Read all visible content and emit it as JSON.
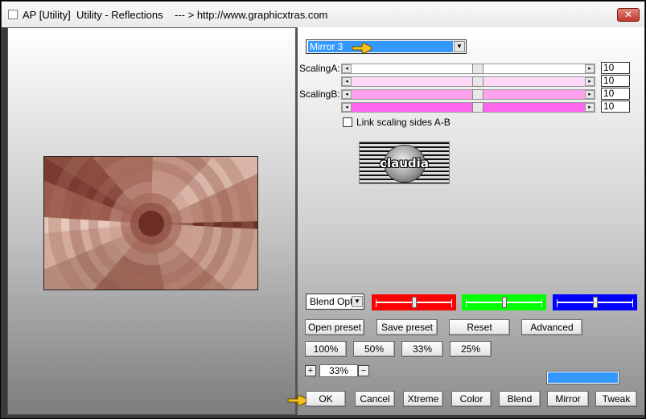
{
  "window": {
    "title": "AP [Utility]  Utility - Reflections    --- > http://www.graphicxtras.com",
    "close_glyph": "✕"
  },
  "mode_dropdown": {
    "value": "Mirror 3"
  },
  "sliders": [
    {
      "label": "ScalingA:",
      "value": "10",
      "color": "#ffffff"
    },
    {
      "label": "",
      "value": "10",
      "color": "#ffd7f7"
    },
    {
      "label": "ScalingB:",
      "value": "10",
      "color": "#ffa2ee"
    },
    {
      "label": "",
      "value": "10",
      "color": "#ff66ee"
    }
  ],
  "link_scaling": {
    "label": "Link scaling sides A-B",
    "checked": false
  },
  "logo": {
    "text": "claudia"
  },
  "blend_dropdown": {
    "value": "Blend Optio"
  },
  "color_sliders": [
    {
      "name": "red",
      "color": "#ff0000",
      "level": 0.5
    },
    {
      "name": "green",
      "color": "#00ff00",
      "level": 0.5
    },
    {
      "name": "blue",
      "color": "#0000ff",
      "level": 0.5
    }
  ],
  "preset_buttons": {
    "open": "Open preset",
    "save": "Save preset",
    "reset": "Reset",
    "advanced": "Advanced"
  },
  "zoom_buttons": [
    "100%",
    "50%",
    "33%",
    "25%"
  ],
  "zoom": {
    "plus": "+",
    "minus": "−",
    "value": "33%"
  },
  "swatch_color": "#3399ff",
  "bottom_buttons": {
    "ok": "OK",
    "cancel": "Cancel",
    "xtreme": "Xtreme",
    "color": "Color",
    "blend": "Blend",
    "mirror": "Mirror",
    "tweak": "Tweak"
  }
}
